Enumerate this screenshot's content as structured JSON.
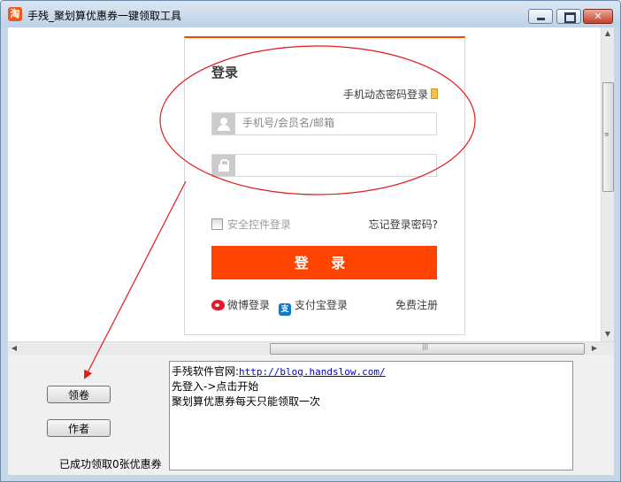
{
  "window": {
    "title": "手残_聚划算优惠券一键领取工具",
    "app_icon_glyph": "淘"
  },
  "login": {
    "title": "登录",
    "mobile_login": "手机动态密码登录",
    "username_placeholder": "手机号/会员名/邮箱",
    "password_placeholder": "",
    "safe_control": "安全控件登录",
    "forgot": "忘记登录密码?",
    "submit": "登 录",
    "weibo": "微博登录",
    "alipay": "支付宝登录",
    "register": "免费注册",
    "alipay_icon_glyph": "支"
  },
  "controls": {
    "claim_button": "领卷",
    "author_button": "作者",
    "status": "已成功领取0张优惠券"
  },
  "log": {
    "site_label": "手残软件官网:",
    "site_url": "http://blog.handslow.com/",
    "line2": "先登入->点击开始",
    "line3": "聚划算优惠券每天只能领取一次"
  },
  "colors": {
    "accent": "#ff4400",
    "annotation": "#e31b1b",
    "link": "#0000cc"
  }
}
